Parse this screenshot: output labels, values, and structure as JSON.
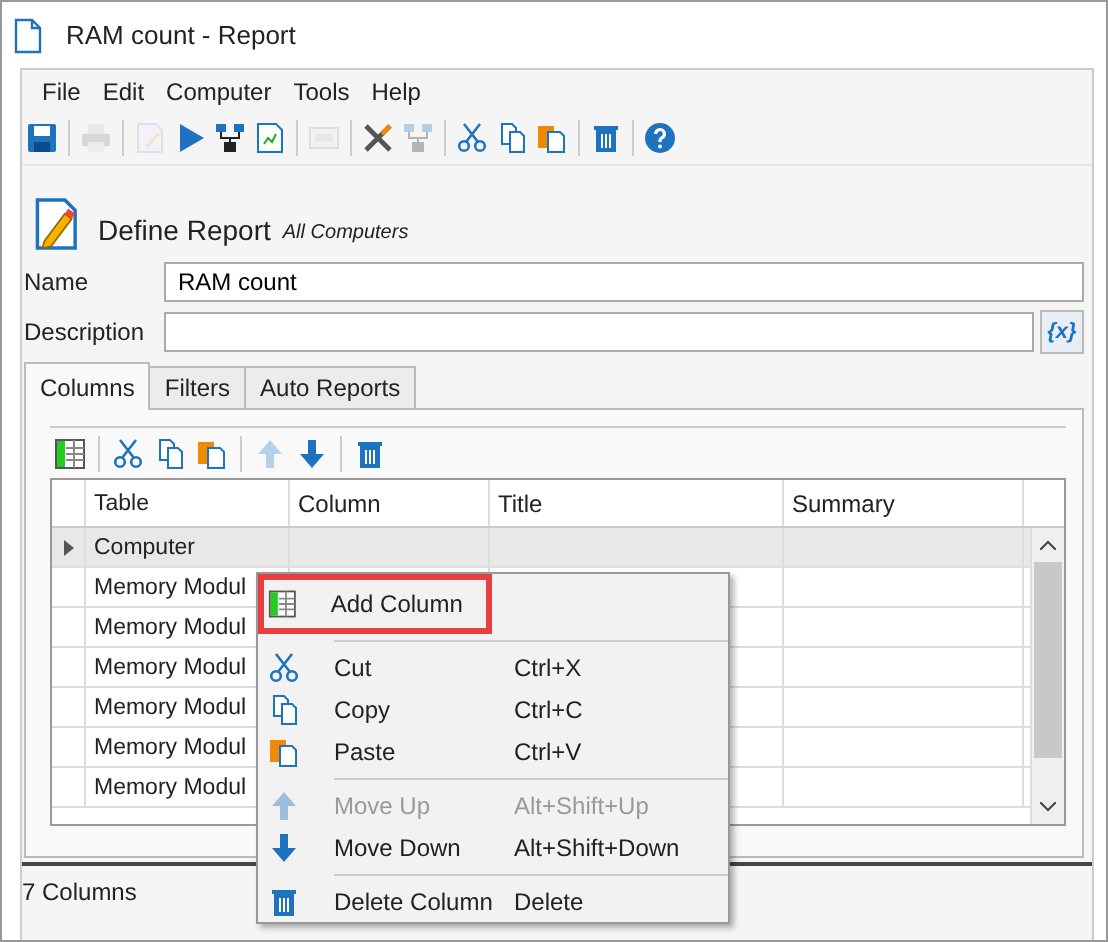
{
  "window": {
    "title": "RAM count - Report"
  },
  "menu_bar": [
    "File",
    "Edit",
    "Computer",
    "Tools",
    "Help"
  ],
  "toolbar": [
    {
      "kind": "save",
      "disabled": false
    },
    {
      "kind": "separator"
    },
    {
      "kind": "print",
      "disabled": true
    },
    {
      "kind": "separator"
    },
    {
      "kind": "edit",
      "disabled": true
    },
    {
      "kind": "run",
      "disabled": false
    },
    {
      "kind": "network",
      "disabled": false
    },
    {
      "kind": "report",
      "disabled": false
    },
    {
      "kind": "separator"
    },
    {
      "kind": "csv",
      "disabled": true
    },
    {
      "kind": "separator"
    },
    {
      "kind": "tools",
      "disabled": false
    },
    {
      "kind": "network",
      "disabled": true
    },
    {
      "kind": "separator"
    },
    {
      "kind": "cut",
      "disabled": false
    },
    {
      "kind": "copy",
      "disabled": false
    },
    {
      "kind": "paste",
      "disabled": false
    },
    {
      "kind": "separator"
    },
    {
      "kind": "delete",
      "disabled": false
    },
    {
      "kind": "separator"
    },
    {
      "kind": "help",
      "disabled": false
    }
  ],
  "header": {
    "title": "Define Report",
    "subtitle": "All Computers"
  },
  "fields": {
    "name_label": "Name",
    "name_value": "RAM count",
    "description_label": "Description",
    "variable_button": "{x}"
  },
  "tabs": [
    {
      "label": "Columns",
      "selected": true
    },
    {
      "label": "Filters",
      "selected": false
    },
    {
      "label": "Auto Reports",
      "selected": false
    }
  ],
  "columns_toolbar": [
    {
      "kind": "add",
      "disabled": false
    },
    {
      "kind": "separator"
    },
    {
      "kind": "cut",
      "disabled": false
    },
    {
      "kind": "copy",
      "disabled": false
    },
    {
      "kind": "paste",
      "disabled": false
    },
    {
      "kind": "separator"
    },
    {
      "kind": "up",
      "disabled": true
    },
    {
      "kind": "down",
      "disabled": false
    },
    {
      "kind": "separator"
    },
    {
      "kind": "delete",
      "disabled": false
    }
  ],
  "table": {
    "columns": [
      "Table",
      "Column",
      "Title",
      "Summary"
    ],
    "rows": [
      {
        "table": "Computer",
        "selected": true
      },
      {
        "table": "Memory Modul",
        "selected": false
      },
      {
        "table": "Memory Modul",
        "selected": false
      },
      {
        "table": "Memory Modul",
        "selected": false
      },
      {
        "table": "Memory Modul",
        "selected": false
      },
      {
        "table": "Memory Modul",
        "selected": false
      },
      {
        "table": "Memory Modul",
        "selected": false
      }
    ]
  },
  "context_menu": [
    {
      "kind": "add",
      "label": "Add Column",
      "disabled": false,
      "selected": true
    },
    {
      "kind": "separator"
    },
    {
      "kind": "cut",
      "label": "Cut",
      "shortcut": "Ctrl+X",
      "disabled": false,
      "selected": false
    },
    {
      "kind": "copy",
      "label": "Copy",
      "shortcut": "Ctrl+C",
      "disabled": false,
      "selected": false
    },
    {
      "kind": "paste",
      "label": "Paste",
      "shortcut": "Ctrl+V",
      "disabled": false,
      "selected": false
    },
    {
      "kind": "separator"
    },
    {
      "kind": "up",
      "label": "Move Up",
      "shortcut": "Alt+Shift+Up",
      "disabled": true,
      "selected": false
    },
    {
      "kind": "down",
      "label": "Move Down",
      "shortcut": "Alt+Shift+Down",
      "disabled": false,
      "selected": false
    },
    {
      "kind": "separator"
    },
    {
      "kind": "delete",
      "label": "Delete Column",
      "shortcut": "Delete",
      "disabled": false,
      "selected": false
    }
  ],
  "status_bar": "7 Columns"
}
